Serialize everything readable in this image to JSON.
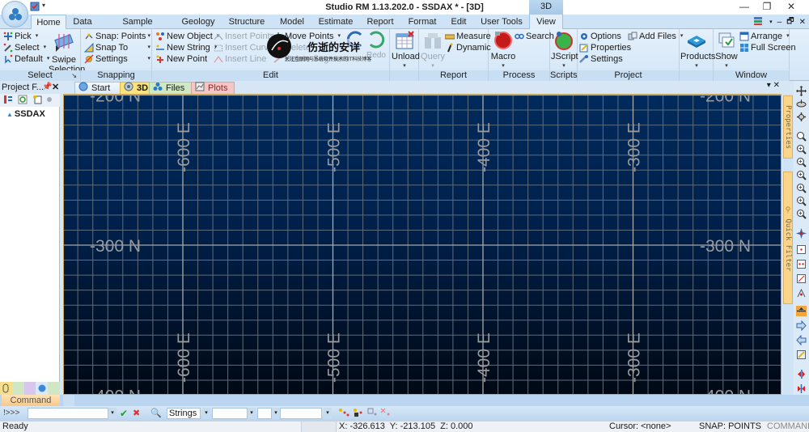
{
  "window": {
    "title": "Studio RM 1.13.202.0 - SSDAX * - [3D]",
    "context_tab_group": "3D",
    "controls": {
      "minimize": "—",
      "restore": "❐",
      "close": "✕"
    }
  },
  "ribbon_tabs": [
    {
      "label": "Home",
      "active": true
    },
    {
      "label": "Data"
    },
    {
      "label": "Sample Analysis"
    },
    {
      "label": "Geology"
    },
    {
      "label": "Structure"
    },
    {
      "label": "Model"
    },
    {
      "label": "Estimate"
    },
    {
      "label": "Report"
    },
    {
      "label": "Format"
    },
    {
      "label": "Edit"
    },
    {
      "label": "User Tools"
    },
    {
      "label": "View"
    }
  ],
  "mdi_controls": {
    "minimize": "‒",
    "restore": "🗗",
    "close": "✕"
  },
  "ribbon": {
    "select": {
      "label": "Select",
      "pick": "Pick",
      "select": "Select",
      "default": "Default",
      "swipe_line1": "Swipe",
      "swipe_line2": "Selection"
    },
    "snapping": {
      "label": "Snapping",
      "snap_points": "Snap: Points",
      "snap_to": "Snap To",
      "settings": "Settings"
    },
    "edit": {
      "label": "Edit",
      "new_object": "New Object",
      "new_string": "New String",
      "new_point": "New Point",
      "insert_points": "Insert Points",
      "insert_curve": "Insert Curve",
      "insert_line": "Insert Line",
      "move_points": "Move Points",
      "delete": "Delete",
      "delete_segment": "Delete Segment",
      "undo": "Undo",
      "redo": "Redo",
      "watermark_title": "伤逝的安详",
      "watermark_sub": "关注互联网与系统软件技术的IT科技博客"
    },
    "unload": {
      "label": "Unload"
    },
    "report": {
      "label": "Report",
      "query": "Query",
      "measure": "Measure",
      "dynamic": "Dynamic"
    },
    "process": {
      "label": "Process",
      "macro": "Macro",
      "search": "Search"
    },
    "scripts": {
      "label": "Scripts",
      "jscript": "JScript"
    },
    "project": {
      "label": "Project",
      "options": "Options",
      "properties": "Properties",
      "settings": "Settings",
      "add_files": "Add Files"
    },
    "products": {
      "label": "Products"
    },
    "window": {
      "label": "Window",
      "show": "Show",
      "arrange": "Arrange",
      "full_screen": "Full Screen"
    }
  },
  "left_panel": {
    "title": "Project F...",
    "pin": "ᵠ",
    "close": "✕",
    "tree_root": "SSDAX"
  },
  "doc_tabs": [
    {
      "label": "Start",
      "color": "#dbe9f7"
    },
    {
      "label": "3D",
      "color": "#fbe27a",
      "active": true
    },
    {
      "label": "Files",
      "color": "#cfe7c2"
    },
    {
      "label": "Plots",
      "color": "#f4c6c6"
    }
  ],
  "doc_controls": {
    "menu": "▾",
    "close": "✕"
  },
  "viewport": {
    "northing_labels": [
      "-200 N",
      "-300 N",
      "-400 N"
    ],
    "easting_labels": [
      "-600 E",
      "-500 E",
      "-400 E",
      "-300 E"
    ],
    "northings": [
      -200,
      -300,
      -400
    ],
    "eastings": [
      -600,
      -500,
      -400,
      -300
    ],
    "minor_grid_interval": 10,
    "major_grid_interval": 100,
    "colors": {
      "minor": "#5f6b7a",
      "major": "#a8a8a8",
      "label": "#9a9a9a"
    }
  },
  "side_tabs": {
    "properties": "Properties",
    "quick_filter": "Quick Filter"
  },
  "command": {
    "tab_label": "Command",
    "prompt": "!>>>",
    "input_value": "",
    "accept": "✔",
    "cancel": "✖",
    "object_type": "Strings",
    "field1": "",
    "field2": "",
    "field3": ""
  },
  "status": {
    "ready": "Ready",
    "coords": "X: -326.613  Y: -213.105  Z: 0.000",
    "cursor": "Cursor: <none>",
    "snap": "SNAP: POINTS",
    "mode": "COMMAND"
  }
}
